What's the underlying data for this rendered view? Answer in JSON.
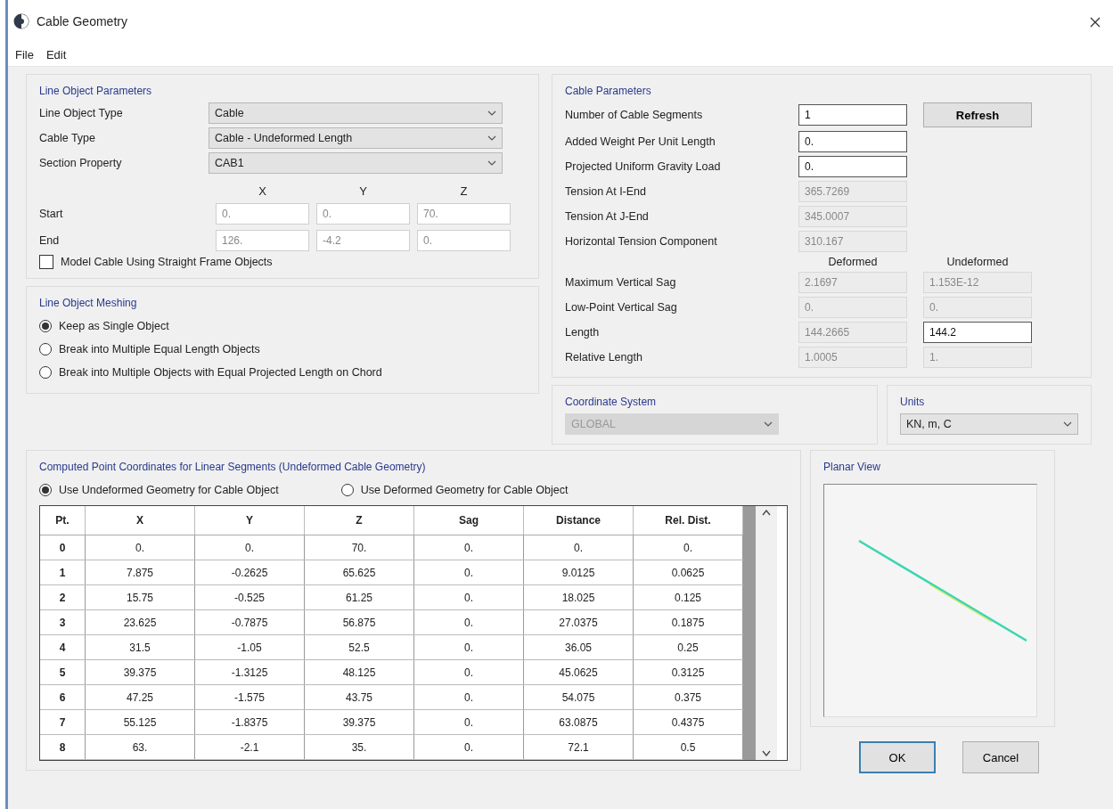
{
  "window": {
    "title": "Cable Geometry"
  },
  "menu": [
    "File",
    "Edit"
  ],
  "line_object_parameters": {
    "title": "Line Object Parameters",
    "dropdowns": [
      {
        "label": "Line Object Type",
        "value": "Cable"
      },
      {
        "label": "Cable Type",
        "value": "Cable - Undeformed Length"
      },
      {
        "label": "Section Property",
        "value": "CAB1"
      }
    ],
    "axes": [
      "X",
      "Y",
      "Z"
    ],
    "points": [
      {
        "label": "Start",
        "values": [
          "0.",
          "0.",
          "70."
        ]
      },
      {
        "label": "End",
        "values": [
          "126.",
          "-4.2",
          "0."
        ]
      }
    ],
    "checkbox": {
      "label": "Model Cable Using Straight Frame Objects",
      "checked": false
    }
  },
  "line_object_meshing": {
    "title": "Line Object Meshing",
    "options": [
      {
        "label": "Keep as Single Object",
        "selected": true
      },
      {
        "label": "Break into Multiple Equal Length Objects",
        "selected": false
      },
      {
        "label": "Break into Multiple Objects with Equal Projected Length on Chord",
        "selected": false
      }
    ]
  },
  "cable_parameters": {
    "title": "Cable Parameters",
    "refresh_button": "Refresh",
    "fields": [
      {
        "label": "Number of Cable Segments",
        "value": "1",
        "disabled": false
      },
      {
        "label": "Added Weight Per Unit Length",
        "value": "0.",
        "disabled": false
      },
      {
        "label": "Projected Uniform Gravity Load",
        "value": "0.",
        "disabled": false
      },
      {
        "label": "Tension At I-End",
        "value": "365.7269",
        "disabled": true
      },
      {
        "label": "Tension At J-End",
        "value": "345.0007",
        "disabled": true
      },
      {
        "label": "Horizontal Tension Component",
        "value": "310.167",
        "disabled": true
      }
    ],
    "columns": [
      "Deformed",
      "Undeformed"
    ],
    "compare_rows": [
      {
        "label": "Maximum Vertical Sag",
        "values": [
          {
            "value": "2.1697",
            "disabled": true
          },
          {
            "value": "1.153E-12",
            "disabled": true
          }
        ]
      },
      {
        "label": "Low-Point Vertical Sag",
        "values": [
          {
            "value": "0.",
            "disabled": true
          },
          {
            "value": "0.",
            "disabled": true
          }
        ]
      },
      {
        "label": "Length",
        "values": [
          {
            "value": "144.2665",
            "disabled": true
          },
          {
            "value": "144.2",
            "disabled": false
          }
        ]
      },
      {
        "label": "Relative Length",
        "values": [
          {
            "value": "1.0005",
            "disabled": true
          },
          {
            "value": "1.",
            "disabled": true
          }
        ]
      }
    ]
  },
  "coordinate_system": {
    "title": "Coordinate System",
    "value": "GLOBAL",
    "disabled": true
  },
  "units": {
    "title": "Units",
    "value": "KN, m, C",
    "disabled": false
  },
  "computed_points": {
    "title": "Computed Point Coordinates for Linear Segments  (Undeformed Cable Geometry)",
    "options": [
      {
        "label": "Use Undeformed Geometry for Cable Object",
        "selected": true
      },
      {
        "label": "Use Deformed Geometry for Cable Object",
        "selected": false
      }
    ],
    "columns": [
      "Pt.",
      "X",
      "Y",
      "Z",
      "Sag",
      "Distance",
      "Rel. Dist."
    ],
    "rows": [
      [
        "0",
        "0.",
        "0.",
        "70.",
        "0.",
        "0.",
        "0."
      ],
      [
        "1",
        "7.875",
        "-0.2625",
        "65.625",
        "0.",
        "9.0125",
        "0.0625"
      ],
      [
        "2",
        "15.75",
        "-0.525",
        "61.25",
        "0.",
        "18.025",
        "0.125"
      ],
      [
        "3",
        "23.625",
        "-0.7875",
        "56.875",
        "0.",
        "27.0375",
        "0.1875"
      ],
      [
        "4",
        "31.5",
        "-1.05",
        "52.5",
        "0.",
        "36.05",
        "0.25"
      ],
      [
        "5",
        "39.375",
        "-1.3125",
        "48.125",
        "0.",
        "45.0625",
        "0.3125"
      ],
      [
        "6",
        "47.25",
        "-1.575",
        "43.75",
        "0.",
        "54.075",
        "0.375"
      ],
      [
        "7",
        "55.125",
        "-1.8375",
        "39.375",
        "0.",
        "63.0875",
        "0.4375"
      ],
      [
        "8",
        "63.",
        "-2.1",
        "35.",
        "0.",
        "72.1",
        "0.5"
      ]
    ]
  },
  "planar_view": {
    "title": "Planar View"
  },
  "buttons": [
    {
      "label": "OK",
      "default": true
    },
    {
      "label": "Cancel",
      "default": false
    }
  ]
}
